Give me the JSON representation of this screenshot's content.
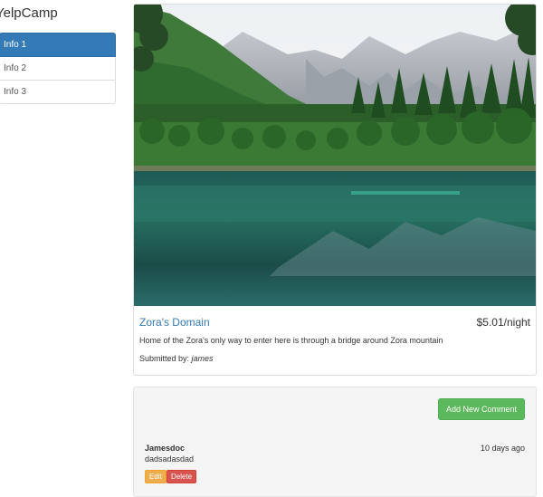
{
  "brand": "YelpCamp",
  "sidebar": {
    "items": [
      {
        "label": "Info 1",
        "active": true
      },
      {
        "label": "Info 2",
        "active": false
      },
      {
        "label": "Info 3",
        "active": false
      }
    ]
  },
  "campground": {
    "name": "Zora's Domain",
    "price": "$5.01/night",
    "description": "Home of the Zora's only way to enter here is through a bridge around Zora mountain",
    "submitted_label": "Submitted by:",
    "author": "james"
  },
  "comments": {
    "add_button": "Add New Comment",
    "items": [
      {
        "author": "Jamesdoc",
        "time": "10 days ago",
        "text": "dadsadasdad",
        "edit_label": "Edit",
        "delete_label": "Delete"
      }
    ]
  },
  "colors": {
    "primary": "#337ab7",
    "success": "#5cb85c",
    "warning": "#f0ad4e",
    "danger": "#d9534f"
  }
}
